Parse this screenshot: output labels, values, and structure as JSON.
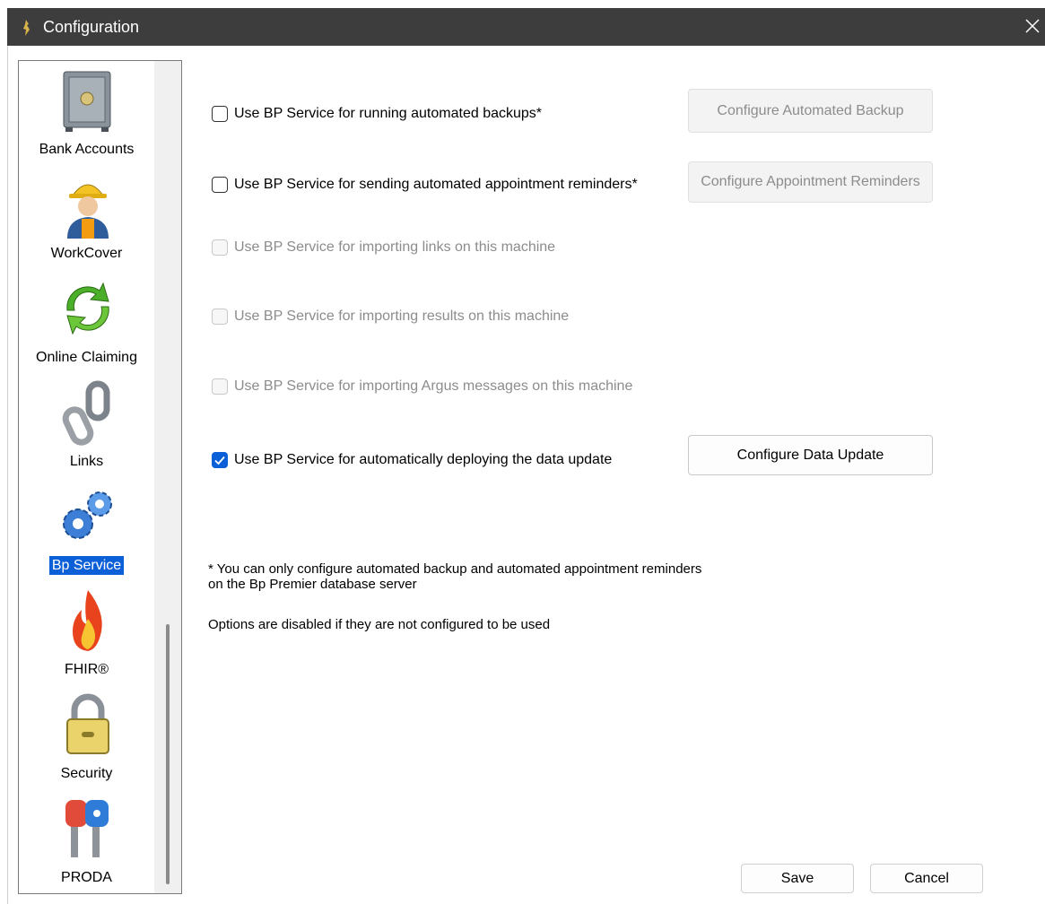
{
  "window": {
    "title": "Configuration"
  },
  "sidebar": {
    "items": [
      {
        "label": "Bank Accounts",
        "icon": "safe-icon"
      },
      {
        "label": "WorkCover",
        "icon": "worker-icon"
      },
      {
        "label": "Online Claiming",
        "icon": "recycle-arrows-icon"
      },
      {
        "label": "Links",
        "icon": "chain-link-icon"
      },
      {
        "label": "Bp Service",
        "icon": "gears-icon",
        "selected": true
      },
      {
        "label": "FHIR®",
        "icon": "flame-icon"
      },
      {
        "label": "Security",
        "icon": "padlock-icon"
      },
      {
        "label": "PRODA",
        "icon": "keys-icon"
      }
    ]
  },
  "options": [
    {
      "label": "Use BP Service for running automated backups*",
      "checked": false,
      "enabled": true
    },
    {
      "label": "Use BP Service for sending automated appointment reminders*",
      "checked": false,
      "enabled": true
    },
    {
      "label": "Use BP Service for importing links on this machine",
      "checked": false,
      "enabled": false
    },
    {
      "label": "Use BP Service for importing results on this machine",
      "checked": false,
      "enabled": false
    },
    {
      "label": "Use BP Service for importing Argus messages on this machine",
      "checked": false,
      "enabled": false
    },
    {
      "label": "Use BP Service for automatically deploying the data update",
      "checked": true,
      "enabled": true
    }
  ],
  "buttons": {
    "configure_backup": "Configure Automated Backup",
    "configure_reminders": "Configure Appointment Reminders",
    "configure_data_update": "Configure Data Update",
    "save": "Save",
    "cancel": "Cancel"
  },
  "notes": {
    "line1": "* You can only configure automated backup and automated appointment reminders",
    "line2": "on the Bp Premier database server",
    "line3": "Options are disabled if they are not configured to be used"
  },
  "colors": {
    "titlebar": "#3d3d3d",
    "accent": "#0b5fd7"
  }
}
